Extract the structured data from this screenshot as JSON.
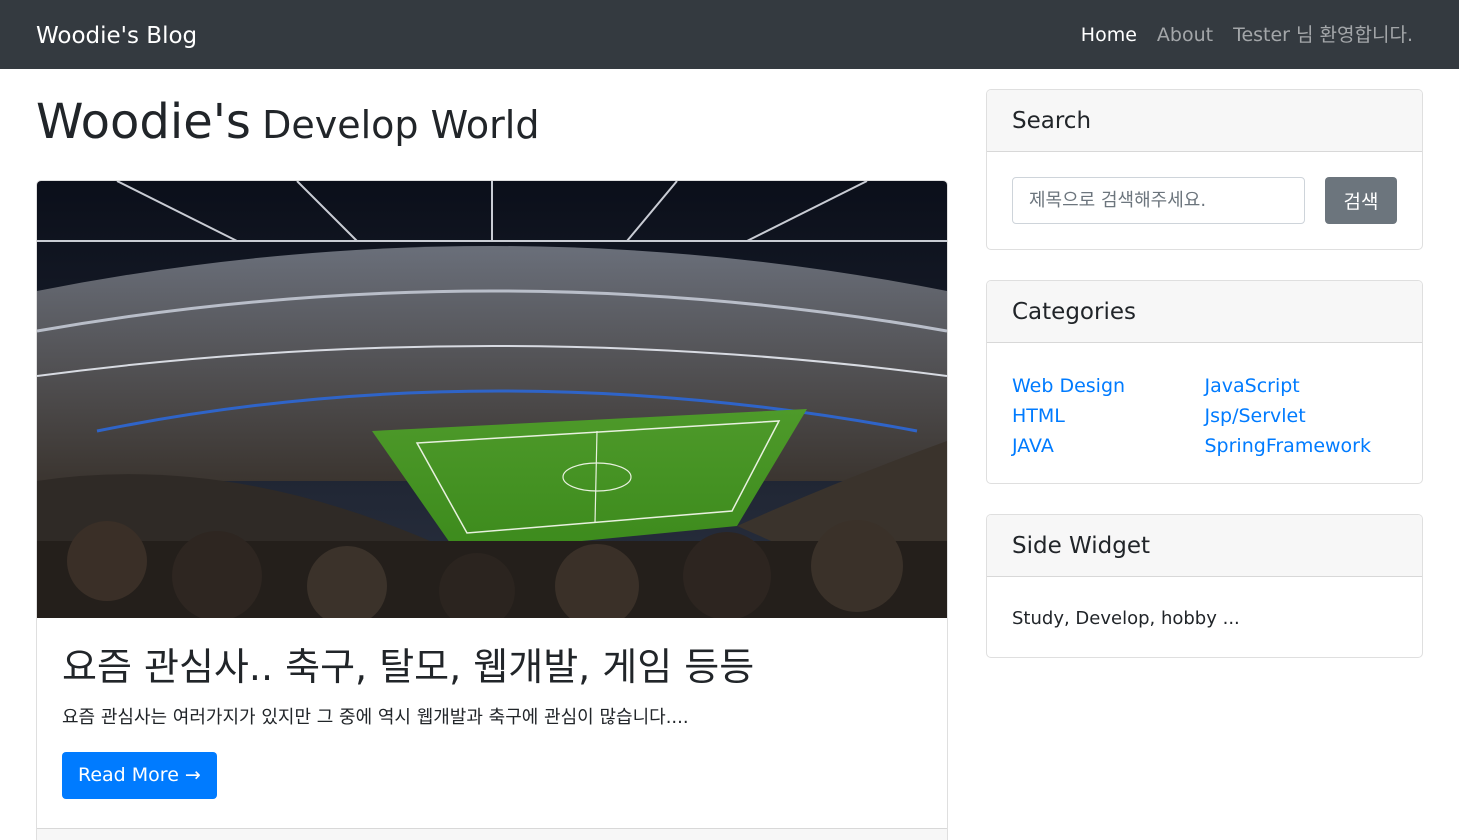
{
  "navbar": {
    "brand": "Woodie's Blog",
    "links": [
      {
        "label": "Home",
        "active": true
      },
      {
        "label": "About",
        "active": false
      },
      {
        "label": "Tester 님 환영합니다.",
        "active": false
      }
    ]
  },
  "page": {
    "heading_main": "Woodie's",
    "heading_sub": "Develop World"
  },
  "post": {
    "image": "stadium-photo",
    "title": "요즘 관심사.. 축구, 탈모, 웹개발, 게임 등등",
    "excerpt": "요즘 관심사는 여러가지가 있지만 그 중에 역시 웹개발과 축구에 관심이 많습니다....",
    "read_more": "Read More →"
  },
  "search": {
    "title": "Search",
    "placeholder": "제목으로 검색해주세요.",
    "value": "",
    "button": "검색"
  },
  "categories": {
    "title": "Categories",
    "left": [
      "Web Design",
      "HTML",
      "JAVA"
    ],
    "right": [
      "JavaScript",
      "Jsp/Servlet",
      "SpringFramework"
    ]
  },
  "side_widget": {
    "title": "Side Widget",
    "text": "Study, Develop, hobby ..."
  },
  "colors": {
    "navbar": "#343a40",
    "primary": "#007bff",
    "secondary": "#6c757d"
  }
}
